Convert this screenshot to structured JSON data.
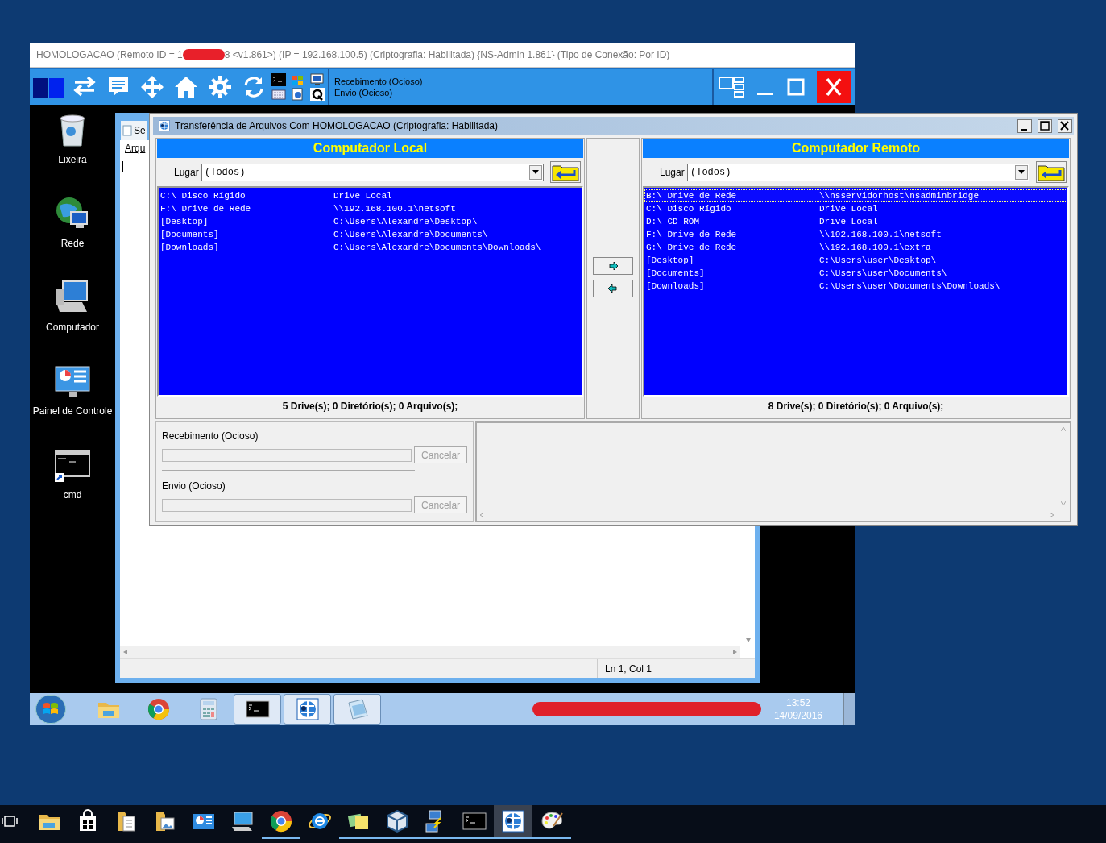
{
  "remote_window": {
    "title_before": "HOMOLOGACAO (Remoto ID = 1",
    "title_after": "8 <v1.861>) (IP = 192.168.100.5)  (Criptografia: Habilitada) {NS-Admin 1.861} (Tipo de Conexão: Por ID)",
    "tools": [
      {
        "kind": "swap"
      },
      {
        "kind": "chat"
      },
      {
        "kind": "move"
      },
      {
        "kind": "home"
      },
      {
        "kind": "gear"
      },
      {
        "kind": "refresh"
      }
    ],
    "status": [
      "Recebimento (Ocioso)",
      "Envio (Ocioso)"
    ]
  },
  "desktop_icons": [
    {
      "label": "Lixeira",
      "kind": "trash"
    },
    {
      "label": "Rede",
      "kind": "network"
    },
    {
      "label": "Computador",
      "kind": "computer"
    },
    {
      "label": "Painel de Controle",
      "kind": "control"
    },
    {
      "label": "cmd",
      "kind": "cmd"
    }
  ],
  "notepad": {
    "tab": "Se",
    "menu": "Arqu",
    "status": "Ln 1, Col 1"
  },
  "transfer": {
    "title": "Transferência de Arquivos Com HOMOLOGACAO (Criptografia: Habilitada)",
    "panels": [
      {
        "header": "Computador Local",
        "lugar_label": "Lugar",
        "lugar_value": "(Todos)",
        "rows": [
          {
            "name": "C:\\ Disco Rígido",
            "info": "Drive Local",
            "selected": false
          },
          {
            "name": "F:\\ Drive de Rede",
            "info": "\\\\192.168.100.1\\netsoft",
            "selected": false
          },
          {
            "name": "[Desktop]",
            "info": "C:\\Users\\Alexandre\\Desktop\\",
            "selected": false
          },
          {
            "name": "[Documents]",
            "info": "C:\\Users\\Alexandre\\Documents\\",
            "selected": false
          },
          {
            "name": "[Downloads]",
            "info": "C:\\Users\\Alexandre\\Documents\\Downloads\\",
            "selected": false
          }
        ],
        "status": "5 Drive(s); 0 Diretório(s); 0 Arquivo(s);"
      },
      {
        "header": "Computador Remoto",
        "lugar_label": "Lugar",
        "lugar_value": "(Todos)",
        "rows": [
          {
            "name": "B:\\ Drive de Rede",
            "info": "\\\\nsservidorhost\\nsadminbridge",
            "selected": true
          },
          {
            "name": "C:\\ Disco Rígido",
            "info": "Drive Local",
            "selected": false
          },
          {
            "name": "D:\\ CD-ROM",
            "info": "Drive Local",
            "selected": false
          },
          {
            "name": "F:\\ Drive de Rede",
            "info": "\\\\192.168.100.1\\netsoft",
            "selected": false
          },
          {
            "name": "G:\\ Drive de Rede",
            "info": "\\\\192.168.100.1\\extra",
            "selected": false
          },
          {
            "name": "[Desktop]",
            "info": "C:\\Users\\user\\Desktop\\",
            "selected": false
          },
          {
            "name": "[Documents]",
            "info": "C:\\Users\\user\\Documents\\",
            "selected": false
          },
          {
            "name": "[Downloads]",
            "info": "C:\\Users\\user\\Documents\\Downloads\\",
            "selected": false
          }
        ],
        "status": "8 Drive(s); 0 Diretório(s); 0 Arquivo(s);"
      }
    ],
    "progress": [
      {
        "label": "Recebimento (Ocioso)",
        "level": 0,
        "button": "Cancelar",
        "disabled": true
      },
      {
        "label": "Envio (Ocioso)",
        "level": 0,
        "button": "Cancelar",
        "disabled": true
      }
    ]
  },
  "remote_taskbar": {
    "apps": [
      {
        "kind": "folder",
        "running": false
      },
      {
        "kind": "chrome",
        "running": false
      },
      {
        "kind": "calc",
        "running": false
      },
      {
        "kind": "cmd",
        "running": true
      },
      {
        "kind": "transfer",
        "running": true
      },
      {
        "kind": "notepad",
        "running": true
      }
    ],
    "time": "13:52",
    "date": "14/09/2016"
  },
  "host_taskbar": {
    "apps": [
      {
        "kind": "folder",
        "running": false,
        "active": false
      },
      {
        "kind": "store",
        "running": false,
        "active": false
      },
      {
        "kind": "docs",
        "running": false,
        "active": false
      },
      {
        "kind": "pictures",
        "running": false,
        "active": false
      },
      {
        "kind": "panel",
        "running": false,
        "active": false
      },
      {
        "kind": "computer",
        "running": false,
        "active": false
      },
      {
        "kind": "chrome",
        "running": true,
        "active": false
      },
      {
        "kind": "ie",
        "running": false,
        "active": false
      },
      {
        "kind": "notes",
        "running": true,
        "active": false
      },
      {
        "kind": "cube",
        "running": true,
        "active": false
      },
      {
        "kind": "network",
        "running": true,
        "active": false
      },
      {
        "kind": "cmd",
        "running": true,
        "active": false
      },
      {
        "kind": "transfer",
        "running": true,
        "active": true
      },
      {
        "kind": "paint",
        "running": true,
        "active": false
      }
    ]
  }
}
